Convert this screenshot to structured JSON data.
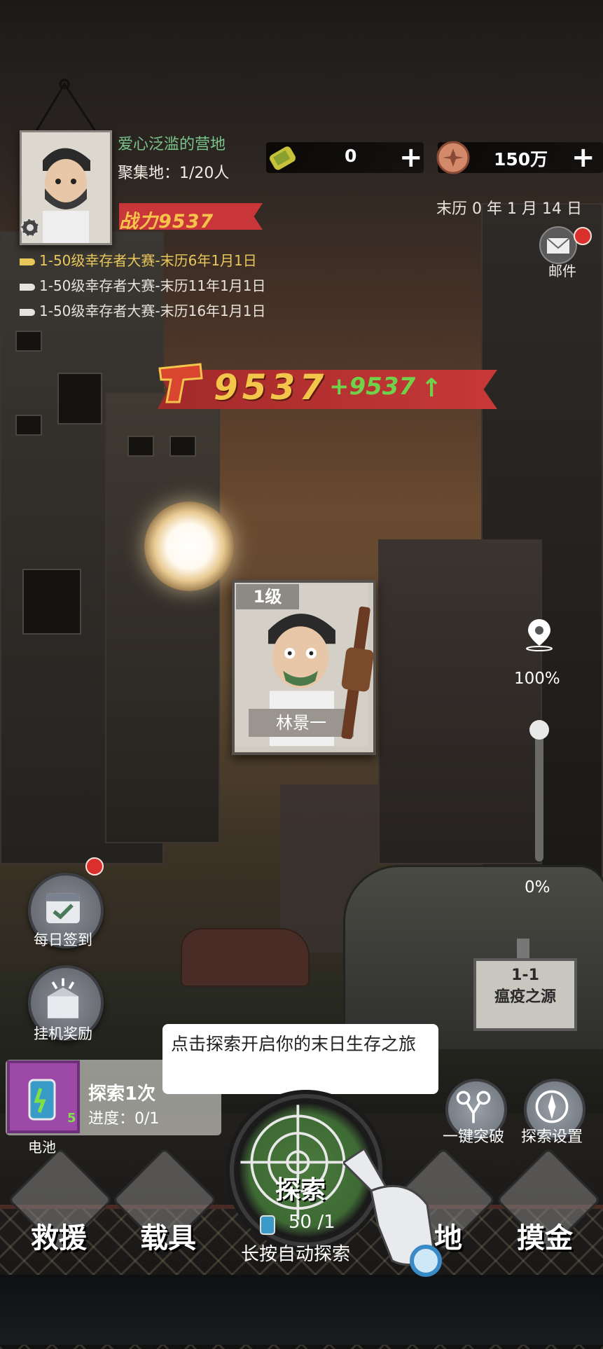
{
  "header": {
    "camp_name": "爱心泛滥的营地",
    "gather_label": "聚集地：1/20人",
    "resource_energy": "0",
    "resource_coin": "150万",
    "power_label": "战力",
    "power_value": "9537",
    "date": "末历 0 年 1 月 14 日",
    "mail_label": "邮件"
  },
  "events": [
    {
      "text": "1-50级幸存者大赛-末历6年1月1日",
      "color": "#e8c85a"
    },
    {
      "text": "1-50级幸存者大赛-末历11年1月1日",
      "color": "#e6e3dc"
    },
    {
      "text": "1-50级幸存者大赛-末历16年1月1日",
      "color": "#e6e3dc"
    }
  ],
  "power_banner": {
    "value": "9537",
    "delta": "+9537"
  },
  "character": {
    "level": "1级",
    "name": "林景一"
  },
  "slider": {
    "top_label": "100%",
    "bottom_label": "0%"
  },
  "stage": {
    "number": "1-1",
    "title": "瘟疫之源"
  },
  "left_buttons": {
    "daily_checkin": "每日签到",
    "idle_reward": "挂机奖励"
  },
  "tooltip": "点击探索开启你的末日生存之旅",
  "explore_panel": {
    "title": "探索1次",
    "progress": "进度：0/1",
    "item_label": "电池",
    "item_count": "5"
  },
  "explore": {
    "label": "探索",
    "energy": "50 /1",
    "auto_hint": "长按自动探索"
  },
  "right_buttons": {
    "breakthrough": "一键突破",
    "settings": "探索设置"
  },
  "bottom_nav": {
    "rescue": "救援",
    "vehicle": "载具",
    "base": "地",
    "loot": "摸金"
  },
  "colors": {
    "ribbon_red": "#c8363a",
    "gold": "#f3c54a",
    "green": "#6fd24a",
    "camp_green": "#7bc38a"
  }
}
